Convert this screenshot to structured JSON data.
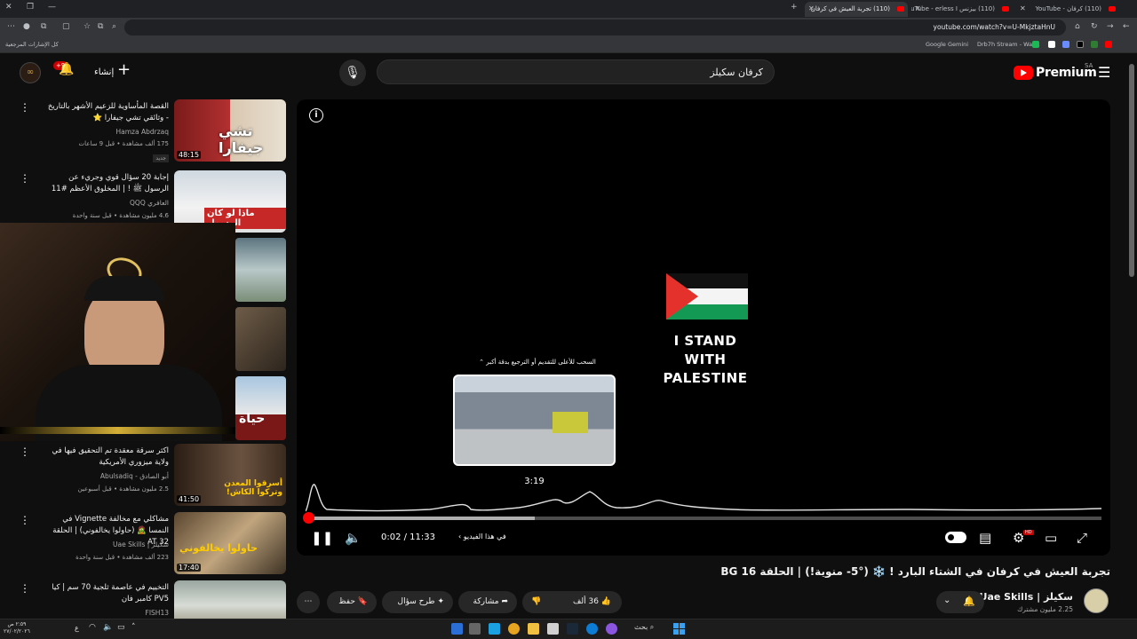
{
  "browser": {
    "tabs": [
      {
        "title": "(110) كرفان - YouTube"
      },
      {
        "title": "(110) بيزنس YouTube - erless I"
      },
      {
        "title": "(110) تجربة العيش في كرفان"
      }
    ],
    "url": "youtube.com/watch?v=U-MkjztaHnU",
    "bookmarks": [
      "Google Gemini",
      "Drb7h Stream - Wat...",
      "كل الإشارات المرجعية"
    ]
  },
  "header": {
    "logo_text": "Premium",
    "region": "SA",
    "search_query": "كرفان سكيلز",
    "create_label": "إنشاء",
    "notif_count": "+9"
  },
  "player": {
    "overlay_text_line1": "I STAND",
    "overlay_text_line2": "WITH",
    "overlay_text_line3": "PALESTINE",
    "preview_hint": "السحب للأعلى للتقديم أو الترجيع بدقة أكبر",
    "preview_time": "3:19",
    "time_display": "0:02 / 11:33",
    "chapter_label": "في هذا الفيديو",
    "progress_fraction": 0.003,
    "hover_fraction": 0.288
  },
  "video": {
    "title": "تجربة العيش في كرفان في الشتاء البارد ! ❄️ (°5- منوية!) | الحلقة BG 16",
    "channel_name": "سكيلز | Uae Skills",
    "subscribers": "2.25 مليون مشترك",
    "like_count": "36 ألف",
    "share_label": "مشاركة",
    "ask_label": "طرح سؤال",
    "save_label": "حفظ"
  },
  "recommendations": [
    {
      "title": "القصة المأساوية للزعيم الأشهر بالتاريخ - وثائقي تشي جيفارا ⭐",
      "channel": "Hamza Abdrzaq",
      "meta": "175 ألف مشاهدة • قبل 9 ساعات",
      "badge": "جديد",
      "duration": "48:15"
    },
    {
      "title": "إجابة 20 سؤال قوي وجريء عن الرسول ﷺ ! | المخلوق الأعظم #11",
      "channel": "العافري QQQ",
      "meta": "4.6 مليون مشاهدة • قبل سنة واحدة",
      "badge": "",
      "duration": ""
    },
    {
      "title": "اكثر سرقة معقدة تم التحقيق فيها في ولاية ميزوري الأمريكية",
      "channel": "أبو الصادق - Abulsadiq",
      "meta": "2.5 مليون مشاهدة • قبل أسبوعين",
      "badge": "",
      "duration": "41:50"
    },
    {
      "title": "مشاكلي مع مخالفة Vignette في النمسا 🧟 (حاولوا يخالفوني) | الحلقة 32 AT",
      "channel": "سكيلز | Uae Skills",
      "meta": "223 ألف مشاهدة • قبل سنة واحدة",
      "badge": "",
      "duration": "17:40"
    },
    {
      "title": "التخييم في عاصمة ثلجية 70 سم | كيا PV5 كامبر فان",
      "channel": "FISH13",
      "meta": "",
      "badge": "",
      "duration": ""
    }
  ],
  "thumb_texts": [
    "تشي جيفارا",
    "ماذا لو كان الرسول",
    "حياة",
    "أسرقوا المعدن وتركوا الكاش!",
    "حاولوا يخالفوني"
  ],
  "taskbar": {
    "search_label": "بحث",
    "clock_time": "٢:٥٩ ص",
    "clock_date": "٢٧/٠٢/٢٠٢٦"
  },
  "colors": {
    "accent": "#ff0000",
    "bg": "#0f0f0f",
    "chip": "#272727"
  }
}
